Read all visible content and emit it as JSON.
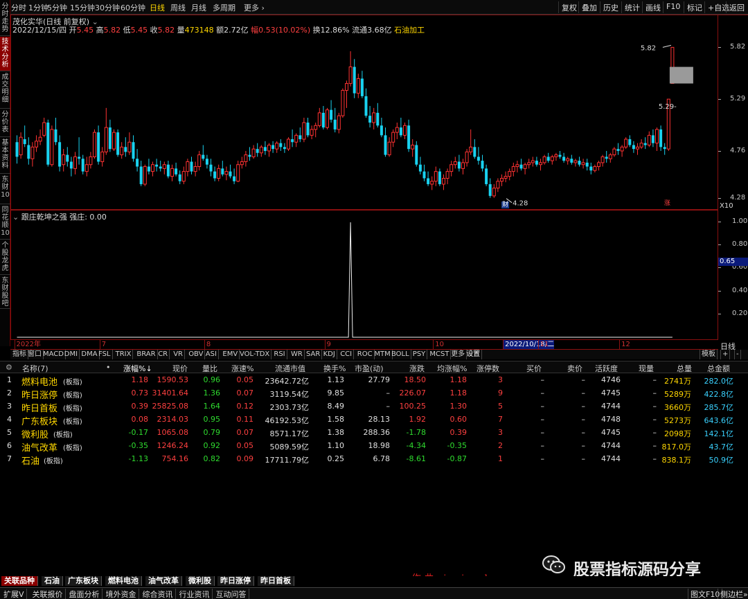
{
  "topbar": {
    "periods": [
      "分时",
      "1分钟",
      "5分钟",
      "15分钟",
      "30分钟",
      "60分钟",
      "日线",
      "周线",
      "月线",
      "多周期",
      "更多 ›"
    ],
    "active_period": "日线",
    "right_buttons": [
      "复权",
      "叠加",
      "历史",
      "统计",
      "画线",
      "F10",
      "标记",
      "+自选",
      "返回"
    ]
  },
  "left_tabs": [
    {
      "label": "分时走势"
    },
    {
      "label": "技术分析",
      "active": true
    },
    {
      "label": "成交明细"
    },
    {
      "label": "分价表"
    },
    {
      "label": "基本资料"
    },
    {
      "label": "东财10"
    },
    {
      "label": "同花顺10"
    },
    {
      "label": "个股龙虎"
    },
    {
      "label": "东财股吧"
    }
  ],
  "main_chart": {
    "title": "茂化实华(日线 前复权)",
    "info_date": "2022/12/15/四",
    "open_label": "开",
    "open": "5.45",
    "high_label": "高",
    "high": "5.82",
    "low_label": "低",
    "low": "5.45",
    "close_label": "收",
    "close": "5.82",
    "volume_label": "量",
    "volume": "473148",
    "amount_label": "额",
    "amount": "2.72亿",
    "change_label": "幅",
    "change": "0.53(10.02%)",
    "turnover": "换12.86%",
    "float": "流通3.68亿",
    "sector": "石油加工",
    "y_ticks": [
      "5.82",
      "5.29",
      "4.76",
      "4.28"
    ],
    "y_values": [
      5.82,
      5.29,
      4.76,
      4.28
    ],
    "y_range": [
      4.2,
      5.95
    ],
    "max_label": "5.82",
    "min_label": "4.28",
    "marker_label": "5.29-",
    "cai_badge": "财",
    "zhang_badge": "涨",
    "x10": "X10",
    "colors": {
      "up": "#ff3232",
      "down": "#19d2f0"
    }
  },
  "indicator_chart": {
    "title": "跟庄乾坤之强",
    "value_label": "强庄: 0.00",
    "y_ticks": [
      "1.00",
      "0.80",
      "0.60",
      "0.40",
      "0.20"
    ],
    "y_values": [
      1.0,
      0.8,
      0.6,
      0.4,
      0.2
    ],
    "highlight_value": "0.65",
    "spike_indices": [
      86,
      173
    ]
  },
  "date_axis": {
    "labels": [
      "2022年",
      "7",
      "8",
      "9",
      "10",
      "2022/10/18/二",
      "11",
      "12"
    ],
    "indices": [
      0,
      22,
      49,
      80,
      108,
      126,
      135,
      156
    ],
    "period_btn": "日线"
  },
  "indicator_tabs": [
    "指标",
    "窗口",
    "MACD",
    "DMI",
    "DMA",
    "FSL",
    "TRIX",
    "BRAR",
    "CR",
    "VR",
    "OBV",
    "ASI",
    "EMV",
    "VOL-TDX",
    "RSI",
    "WR",
    "SAR",
    "KDJ",
    "CCI",
    "ROC",
    "MTM",
    "BOLL",
    "PSY",
    "MCST",
    "更多",
    "设置"
  ],
  "indicator_tabs_right": [
    "模板",
    "+",
    "-"
  ],
  "table": {
    "headers": [
      "名称(7)",
      "•",
      "涨幅%↓",
      "现价",
      "量比",
      "涨速%",
      "流通市值",
      "换手%",
      "市盈(动)",
      "涨跌",
      "均涨幅%",
      "涨停数",
      "买价",
      "卖价",
      "活跃度",
      "现量",
      "总量",
      "总金额"
    ],
    "rows": [
      {
        "no": "1",
        "name": "燃料电池",
        "tag": "(板指)",
        "chg": "1.18",
        "price": "1590.53",
        "vr": "0.96",
        "speed": "0.05",
        "mcap": "23642.72亿",
        "turn": "1.13",
        "pe": "27.79",
        "diff": "18.50",
        "avg": "1.18",
        "limit": "3",
        "buy": "–",
        "sell": "–",
        "act": "4746",
        "cur": "–",
        "vol": "2741万",
        "amt": "282.0亿",
        "up": true
      },
      {
        "no": "2",
        "name": "昨日涨停",
        "tag": "(板指)",
        "chg": "0.73",
        "price": "31401.64",
        "vr": "1.36",
        "speed": "0.07",
        "mcap": "3119.54亿",
        "turn": "9.85",
        "pe": "–",
        "diff": "226.07",
        "avg": "1.18",
        "limit": "9",
        "buy": "–",
        "sell": "–",
        "act": "4745",
        "cur": "–",
        "vol": "5289万",
        "amt": "422.8亿",
        "up": true
      },
      {
        "no": "3",
        "name": "昨日首板",
        "tag": "(板指)",
        "chg": "0.39",
        "price": "25825.08",
        "vr": "1.64",
        "speed": "0.12",
        "mcap": "2303.73亿",
        "turn": "8.49",
        "pe": "–",
        "diff": "100.25",
        "avg": "1.30",
        "limit": "5",
        "buy": "–",
        "sell": "–",
        "act": "4744",
        "cur": "–",
        "vol": "3660万",
        "amt": "285.7亿",
        "up": true
      },
      {
        "no": "4",
        "name": "广东板块",
        "tag": "(板指)",
        "chg": "0.08",
        "price": "2314.03",
        "vr": "0.95",
        "speed": "0.11",
        "mcap": "46192.53亿",
        "turn": "1.58",
        "pe": "28.13",
        "diff": "1.92",
        "avg": "0.60",
        "limit": "7",
        "buy": "–",
        "sell": "–",
        "act": "4748",
        "cur": "–",
        "vol": "5273万",
        "amt": "643.6亿",
        "up": true
      },
      {
        "no": "5",
        "name": "微利股",
        "tag": "(板指)",
        "chg": "-0.17",
        "price": "1065.08",
        "vr": "0.79",
        "speed": "0.07",
        "mcap": "8571.17亿",
        "turn": "1.38",
        "pe": "288.36",
        "diff": "-1.78",
        "avg": "0.39",
        "limit": "3",
        "buy": "–",
        "sell": "–",
        "act": "4745",
        "cur": "–",
        "vol": "2098万",
        "amt": "142.1亿",
        "up": false
      },
      {
        "no": "6",
        "name": "油气改革",
        "tag": "(板指)",
        "chg": "-0.35",
        "price": "1246.24",
        "vr": "0.92",
        "speed": "0.05",
        "mcap": "5089.59亿",
        "turn": "1.10",
        "pe": "18.98",
        "diff": "-4.34",
        "avg": "-0.35",
        "limit": "2",
        "buy": "–",
        "sell": "–",
        "act": "4744",
        "cur": "–",
        "vol": "817.0万",
        "amt": "43.7亿",
        "up": false
      },
      {
        "no": "7",
        "name": "石油",
        "tag": "(板指)",
        "chg": "-1.13",
        "price": "754.16",
        "vr": "0.82",
        "speed": "0.09",
        "mcap": "17711.79亿",
        "turn": "0.25",
        "pe": "6.78",
        "diff": "-8.61",
        "avg": "-0.87",
        "limit": "1",
        "buy": "–",
        "sell": "–",
        "act": "4744",
        "cur": "–",
        "vol": "838.1万",
        "amt": "50.9亿",
        "up": false
      }
    ]
  },
  "watermark": {
    "brand": "股票指标源码分享",
    "author": "作 曲 : jami soul"
  },
  "block_tabs": [
    "关联品种",
    "石油",
    "广东板块",
    "燃料电池",
    "油气改革",
    "微利股",
    "昨日涨停",
    "昨日首板"
  ],
  "status_bar": {
    "left": [
      "扩展V",
      "关联报价",
      "盘面分析",
      "境外资金",
      "综合资讯",
      "行业资讯",
      "互动问答"
    ],
    "right": [
      "图文F10",
      "侧边栏»"
    ]
  },
  "chart_data": {
    "type": "candlestick",
    "title": "茂化实华(日线 前复权)",
    "ylim": [
      4.2,
      5.95
    ],
    "ohlc": [
      [
        4.85,
        4.92,
        4.63,
        4.7
      ],
      [
        4.72,
        4.95,
        4.68,
        4.9
      ],
      [
        4.88,
        5.02,
        4.8,
        4.83
      ],
      [
        4.82,
        4.9,
        4.62,
        4.68
      ],
      [
        4.68,
        4.85,
        4.6,
        4.8
      ],
      [
        4.8,
        4.92,
        4.75,
        4.86
      ],
      [
        4.86,
        4.98,
        4.82,
        4.9
      ],
      [
        4.92,
        5.1,
        4.9,
        5.05
      ],
      [
        5.05,
        5.08,
        4.6,
        4.62
      ],
      [
        4.62,
        5.02,
        4.6,
        4.98
      ],
      [
        4.98,
        5.1,
        4.82,
        4.85
      ],
      [
        4.85,
        4.92,
        4.55,
        4.6
      ],
      [
        4.62,
        4.78,
        4.55,
        4.72
      ],
      [
        4.72,
        4.8,
        4.6,
        4.65
      ],
      [
        4.65,
        4.7,
        4.5,
        4.58
      ],
      [
        4.58,
        4.75,
        4.52,
        4.7
      ],
      [
        4.7,
        4.9,
        4.62,
        4.68
      ],
      [
        4.68,
        4.72,
        4.52,
        4.55
      ],
      [
        4.55,
        4.7,
        4.5,
        4.62
      ],
      [
        4.62,
        4.75,
        4.58,
        4.7
      ],
      [
        4.7,
        4.98,
        4.68,
        4.95
      ],
      [
        4.95,
        5.02,
        4.62,
        4.65
      ],
      [
        4.65,
        4.8,
        4.6,
        4.75
      ],
      [
        4.75,
        5.2,
        4.72,
        5.0
      ],
      [
        5.0,
        5.08,
        4.75,
        4.78
      ],
      [
        4.78,
        4.98,
        4.76,
        4.95
      ],
      [
        4.95,
        4.98,
        4.7,
        4.72
      ],
      [
        4.72,
        4.85,
        4.68,
        4.8
      ],
      [
        4.8,
        4.9,
        4.7,
        4.75
      ],
      [
        4.75,
        4.95,
        4.72,
        4.85
      ],
      [
        4.85,
        4.92,
        4.65,
        4.68
      ],
      [
        4.68,
        4.78,
        4.55,
        4.6
      ],
      [
        4.6,
        4.66,
        4.4,
        4.42
      ],
      [
        4.42,
        4.62,
        4.4,
        4.6
      ],
      [
        4.6,
        4.68,
        4.52,
        4.55
      ],
      [
        4.55,
        4.65,
        4.5,
        4.62
      ],
      [
        4.62,
        4.68,
        4.55,
        4.6
      ],
      [
        4.6,
        4.66,
        4.55,
        4.58
      ],
      [
        4.58,
        4.65,
        4.52,
        4.62
      ],
      [
        4.62,
        4.66,
        4.48,
        4.5
      ],
      [
        4.5,
        4.62,
        4.45,
        4.58
      ],
      [
        4.58,
        4.64,
        4.5,
        4.52
      ],
      [
        4.52,
        4.56,
        4.42,
        4.45
      ],
      [
        4.45,
        4.6,
        4.42,
        4.55
      ],
      [
        4.55,
        4.68,
        4.5,
        4.65
      ],
      [
        4.65,
        4.7,
        4.52,
        4.55
      ],
      [
        4.55,
        4.65,
        4.5,
        4.6
      ],
      [
        4.6,
        4.76,
        4.56,
        4.72
      ],
      [
        4.72,
        4.82,
        4.66,
        4.68
      ],
      [
        4.68,
        4.72,
        4.58,
        4.62
      ],
      [
        4.62,
        4.68,
        4.5,
        4.55
      ],
      [
        4.55,
        4.6,
        4.45,
        4.48
      ],
      [
        4.48,
        4.62,
        4.45,
        4.58
      ],
      [
        4.58,
        4.66,
        4.5,
        4.52
      ],
      [
        4.52,
        4.6,
        4.46,
        4.55
      ],
      [
        4.55,
        4.62,
        4.48,
        4.5
      ],
      [
        4.5,
        4.58,
        4.42,
        4.45
      ],
      [
        4.45,
        4.66,
        4.44,
        4.62
      ],
      [
        4.62,
        4.7,
        4.58,
        4.65
      ],
      [
        4.65,
        4.76,
        4.6,
        4.72
      ],
      [
        4.72,
        4.8,
        4.66,
        4.7
      ],
      [
        4.7,
        4.82,
        4.68,
        4.78
      ],
      [
        4.78,
        4.84,
        4.7,
        4.74
      ],
      [
        4.74,
        4.82,
        4.7,
        4.8
      ],
      [
        4.8,
        4.86,
        4.72,
        4.76
      ],
      [
        4.76,
        4.84,
        4.7,
        4.82
      ],
      [
        4.82,
        4.86,
        4.74,
        4.78
      ],
      [
        4.78,
        4.86,
        4.74,
        4.84
      ],
      [
        4.84,
        4.88,
        4.76,
        4.8
      ],
      [
        4.8,
        4.84,
        4.74,
        4.78
      ],
      [
        4.78,
        4.9,
        4.76,
        4.88
      ],
      [
        4.88,
        4.98,
        4.8,
        4.85
      ],
      [
        4.85,
        4.94,
        4.8,
        4.92
      ],
      [
        4.92,
        5.0,
        4.85,
        4.88
      ],
      [
        4.88,
        5.1,
        4.85,
        5.05
      ],
      [
        5.05,
        5.1,
        4.9,
        4.92
      ],
      [
        4.92,
        5.02,
        4.88,
        4.98
      ],
      [
        4.98,
        5.05,
        4.9,
        5.02
      ],
      [
        5.02,
        5.2,
        5.0,
        5.15
      ],
      [
        5.15,
        5.22,
        4.98,
        5.0
      ],
      [
        5.0,
        5.2,
        4.98,
        5.18
      ],
      [
        5.18,
        5.28,
        5.05,
        5.08
      ],
      [
        5.08,
        5.2,
        4.95,
        4.98
      ],
      [
        4.98,
        5.15,
        4.94,
        5.12
      ],
      [
        5.12,
        5.4,
        5.1,
        5.38
      ],
      [
        5.38,
        5.48,
        5.2,
        5.45
      ],
      [
        5.45,
        5.78,
        5.42,
        5.62
      ],
      [
        5.62,
        5.7,
        5.3,
        5.35
      ],
      [
        5.35,
        5.55,
        5.3,
        5.5
      ],
      [
        5.5,
        5.58,
        5.3,
        5.32
      ],
      [
        5.32,
        5.4,
        5.1,
        5.12
      ],
      [
        5.12,
        5.22,
        5.0,
        5.05
      ],
      [
        5.05,
        5.2,
        4.98,
        5.15
      ],
      [
        5.15,
        5.25,
        5.0,
        5.02
      ],
      [
        5.02,
        5.1,
        4.9,
        4.92
      ],
      [
        4.92,
        5.0,
        4.7,
        4.72
      ],
      [
        4.72,
        4.9,
        4.7,
        4.85
      ],
      [
        4.85,
        4.98,
        4.8,
        4.95
      ],
      [
        4.95,
        5.05,
        4.88,
        5.0
      ],
      [
        5.0,
        5.1,
        4.9,
        4.92
      ],
      [
        4.92,
        5.05,
        4.88,
        5.02
      ],
      [
        5.02,
        5.08,
        4.75,
        4.78
      ],
      [
        4.78,
        4.88,
        4.7,
        4.82
      ],
      [
        4.82,
        4.86,
        4.6,
        4.62
      ],
      [
        4.62,
        4.7,
        4.52,
        4.55
      ],
      [
        4.55,
        4.62,
        4.45,
        4.48
      ],
      [
        4.48,
        4.55,
        4.4,
        4.42
      ],
      [
        4.42,
        4.5,
        4.36,
        4.45
      ],
      [
        4.45,
        4.6,
        4.4,
        4.55
      ],
      [
        4.55,
        4.58,
        4.4,
        4.42
      ],
      [
        4.42,
        4.52,
        4.36,
        4.48
      ],
      [
        4.48,
        4.58,
        4.42,
        4.55
      ],
      [
        4.55,
        4.66,
        4.5,
        4.62
      ],
      [
        4.62,
        4.7,
        4.58,
        4.65
      ],
      [
        4.65,
        4.72,
        4.55,
        4.58
      ],
      [
        4.58,
        4.68,
        4.52,
        4.64
      ],
      [
        4.64,
        4.78,
        4.6,
        4.75
      ],
      [
        4.75,
        4.98,
        4.72,
        4.8
      ],
      [
        4.8,
        4.88,
        4.68,
        4.7
      ],
      [
        4.7,
        4.8,
        4.62,
        4.66
      ],
      [
        4.66,
        4.72,
        4.55,
        4.58
      ],
      [
        4.58,
        4.62,
        4.4,
        4.42
      ],
      [
        4.42,
        4.48,
        4.28,
        4.3
      ],
      [
        4.3,
        4.42,
        4.28,
        4.38
      ],
      [
        4.38,
        4.48,
        4.34,
        4.45
      ],
      [
        4.45,
        4.52,
        4.4,
        4.48
      ],
      [
        4.48,
        4.55,
        4.44,
        4.5
      ],
      [
        4.5,
        4.58,
        4.46,
        4.55
      ],
      [
        4.55,
        4.64,
        4.5,
        4.6
      ],
      [
        4.6,
        4.66,
        4.54,
        4.62
      ],
      [
        4.62,
        4.68,
        4.56,
        4.58
      ],
      [
        4.58,
        4.64,
        4.52,
        4.62
      ],
      [
        4.62,
        4.68,
        4.58,
        4.64
      ],
      [
        4.64,
        4.7,
        4.6,
        4.66
      ],
      [
        4.66,
        4.7,
        4.6,
        4.62
      ],
      [
        4.62,
        4.68,
        4.56,
        4.64
      ],
      [
        4.64,
        4.72,
        4.62,
        4.7
      ],
      [
        4.7,
        4.74,
        4.64,
        4.66
      ],
      [
        4.66,
        4.72,
        4.62,
        4.7
      ],
      [
        4.7,
        4.74,
        4.66,
        4.72
      ],
      [
        4.72,
        4.76,
        4.68,
        4.7
      ],
      [
        4.7,
        4.74,
        4.64,
        4.66
      ],
      [
        4.66,
        4.7,
        4.62,
        4.68
      ],
      [
        4.68,
        4.72,
        4.62,
        4.64
      ],
      [
        4.64,
        4.68,
        4.6,
        4.66
      ],
      [
        4.66,
        4.7,
        4.6,
        4.62
      ],
      [
        4.62,
        4.68,
        4.58,
        4.64
      ],
      [
        4.64,
        4.68,
        4.56,
        4.6
      ],
      [
        4.6,
        4.64,
        4.52,
        4.56
      ],
      [
        4.56,
        4.62,
        4.54,
        4.6
      ],
      [
        4.6,
        4.66,
        4.56,
        4.64
      ],
      [
        4.64,
        4.72,
        4.6,
        4.7
      ],
      [
        4.7,
        4.76,
        4.64,
        4.68
      ],
      [
        4.68,
        4.74,
        4.64,
        4.72
      ],
      [
        4.72,
        4.8,
        4.7,
        4.78
      ],
      [
        4.78,
        4.84,
        4.72,
        4.76
      ],
      [
        4.76,
        4.82,
        4.7,
        4.8
      ],
      [
        4.8,
        4.9,
        4.78,
        4.88
      ],
      [
        4.88,
        4.92,
        4.8,
        4.82
      ],
      [
        4.82,
        4.86,
        4.74,
        4.78
      ],
      [
        4.78,
        4.84,
        4.72,
        4.8
      ],
      [
        4.8,
        4.88,
        4.78,
        4.84
      ],
      [
        4.84,
        4.9,
        4.78,
        4.82
      ],
      [
        4.82,
        4.96,
        4.8,
        4.92
      ],
      [
        4.92,
        4.98,
        4.8,
        4.84
      ],
      [
        4.84,
        5.0,
        4.76,
        4.98
      ],
      [
        4.98,
        5.02,
        4.76,
        4.8
      ],
      [
        4.8,
        4.84,
        4.72,
        4.78
      ],
      [
        4.78,
        5.29,
        4.76,
        5.29
      ],
      [
        5.45,
        5.82,
        5.45,
        5.82
      ]
    ]
  }
}
